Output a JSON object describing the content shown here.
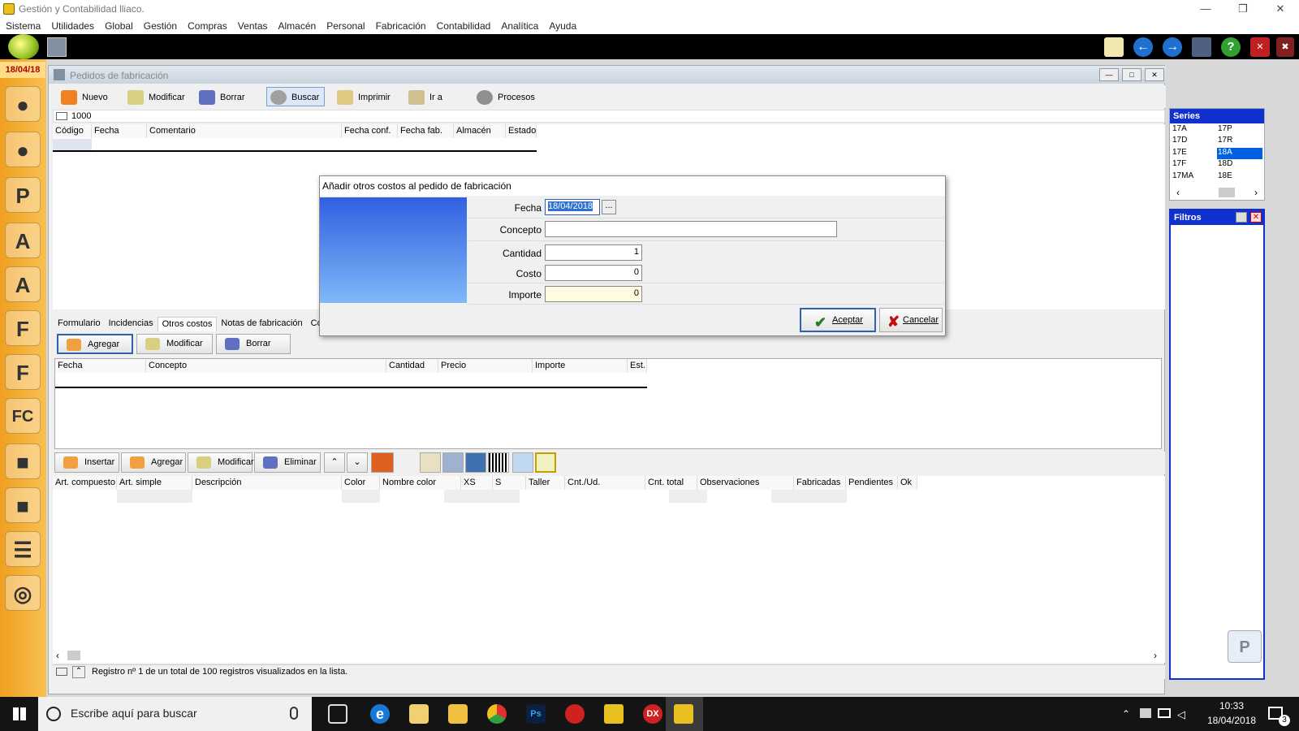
{
  "app": {
    "title": "Gestión y Contabilidad lliaco.",
    "date": "18/04/18"
  },
  "menu": [
    "Sistema",
    "Utilidades",
    "Global",
    "Gestión",
    "Compras",
    "Ventas",
    "Almacén",
    "Personal",
    "Fabricación",
    "Contabilidad",
    "Analítica",
    "Ayuda"
  ],
  "window": {
    "title": "Pedidos de fabricación",
    "code": "1000"
  },
  "toolbar": {
    "nuevo": "Nuevo",
    "modificar": "Modificar",
    "borrar": "Borrar",
    "buscar": "Buscar",
    "imprimir": "Imprimir",
    "ira": "Ir a",
    "procesos": "Procesos"
  },
  "orders_grid": {
    "columns": [
      "Código",
      "Fecha",
      "Comentario",
      "Fecha conf.",
      "Fecha fab.",
      "Almacén",
      "Estado"
    ]
  },
  "series": {
    "title": "Series",
    "items": [
      "17A",
      "17P",
      "17D",
      "17R",
      "17E",
      "18A",
      "17F",
      "18D",
      "17MA",
      "18E"
    ],
    "selected": "18A"
  },
  "filtros": {
    "title": "Filtros"
  },
  "tabs": [
    "Formulario",
    "Incidencias",
    "Otros costos",
    "Notas de fabricación",
    "Co"
  ],
  "sub_buttons": {
    "agregar": "Agregar",
    "modificar": "Modificar",
    "borrar": "Borrar"
  },
  "costs_grid": {
    "columns": [
      "Fecha",
      "Concepto",
      "Cantidad",
      "Precio",
      "Importe",
      "Est."
    ]
  },
  "lines_toolbar": {
    "insertar": "Insertar",
    "agregar": "Agregar",
    "modificar": "Modificar",
    "eliminar": "Eliminar"
  },
  "lines_grid": {
    "columns": [
      "Art. compuesto",
      "Art. simple",
      "Descripción",
      "Color",
      "Nombre color",
      "XS",
      "S",
      "Taller",
      "Cnt./Ud.",
      "Cnt. total",
      "Observaciones",
      "Fabricadas",
      "Pendientes",
      "Ok"
    ]
  },
  "status": {
    "text": "Registro nº 1 de un total de 100 registros visualizados en la lista."
  },
  "dialog": {
    "title": "Añadir otros costos al pedido de fabricación",
    "fecha_label": "Fecha",
    "fecha": "18/04/2018",
    "picker": "...",
    "concepto_label": "Concepto",
    "concepto": "",
    "cantidad_label": "Cantidad",
    "cantidad": "1",
    "costo_label": "Costo",
    "costo": "0",
    "importe_label": "Importe",
    "importe": "0",
    "aceptar": "Aceptar",
    "cancelar": "Cancelar"
  },
  "taskbar": {
    "search_placeholder": "Escribe aquí para buscar",
    "time": "10:33",
    "date": "18/04/2018",
    "notif_count": "3"
  }
}
